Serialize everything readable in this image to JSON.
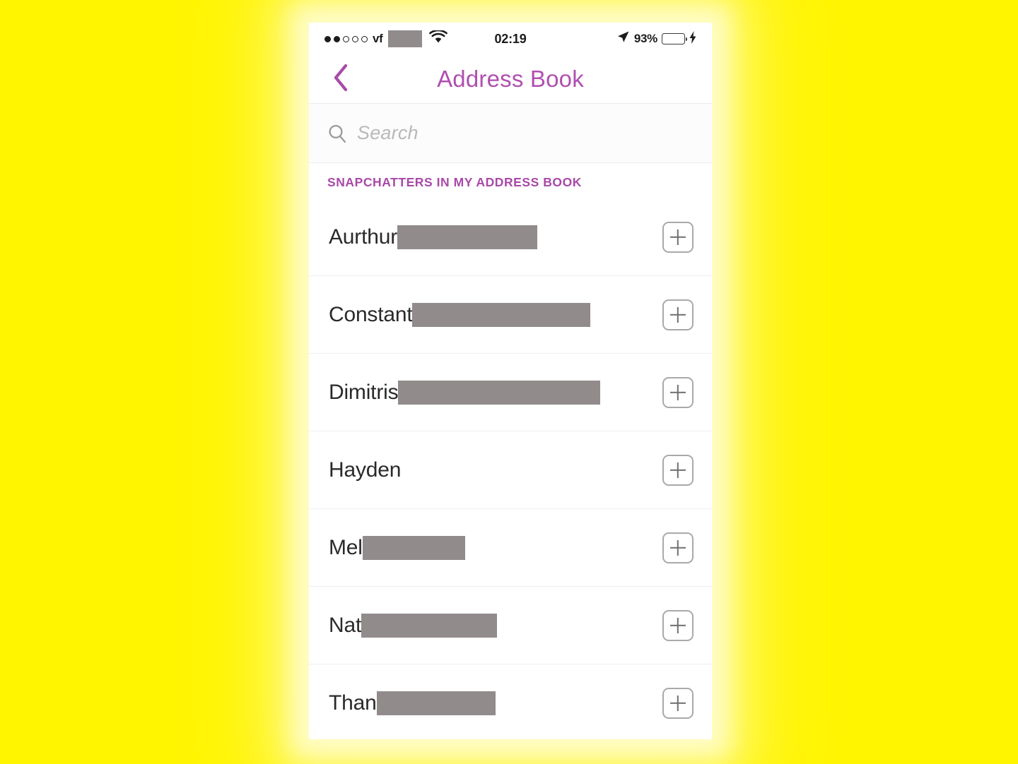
{
  "background": {
    "color": "#fff500",
    "glow_color": "#ffffff"
  },
  "status_bar": {
    "carrier_label": "vf",
    "signal_dots_total": 5,
    "signal_dots_filled": 2,
    "wifi_icon": "wifi-icon",
    "carrier_name_redacted": true,
    "time": "02:19",
    "location_icon": "location-arrow-icon",
    "battery_percent": "93%",
    "battery_level": 93,
    "battery_color": "#3ad736",
    "charging_icon": "lightning-bolt-icon"
  },
  "nav_bar": {
    "back_icon": "chevron-left-icon",
    "title": "Address Book",
    "title_color": "#b04fb0"
  },
  "search": {
    "icon": "search-icon",
    "placeholder": "Search",
    "value": ""
  },
  "section": {
    "header": "SNAPCHATTERS IN MY ADDRESS BOOK",
    "header_color": "#a849a8"
  },
  "contacts": [
    {
      "name": "Aurthur",
      "redaction_width": 198,
      "add_icon": "plus-square-icon"
    },
    {
      "name": "Constant",
      "redaction_width": 252,
      "add_icon": "plus-square-icon"
    },
    {
      "name": "Dimitris",
      "redaction_width": 286,
      "add_icon": "plus-square-icon"
    },
    {
      "name": "Hayden",
      "redaction_width": 0,
      "add_icon": "plus-square-icon"
    },
    {
      "name": "Mel",
      "redaction_width": 145,
      "add_icon": "plus-square-icon"
    },
    {
      "name": "Nat",
      "redaction_width": 192,
      "add_icon": "plus-square-icon"
    },
    {
      "name": "Than",
      "redaction_width": 168,
      "add_icon": "plus-square-icon"
    }
  ],
  "redaction_color": "#918b8b"
}
